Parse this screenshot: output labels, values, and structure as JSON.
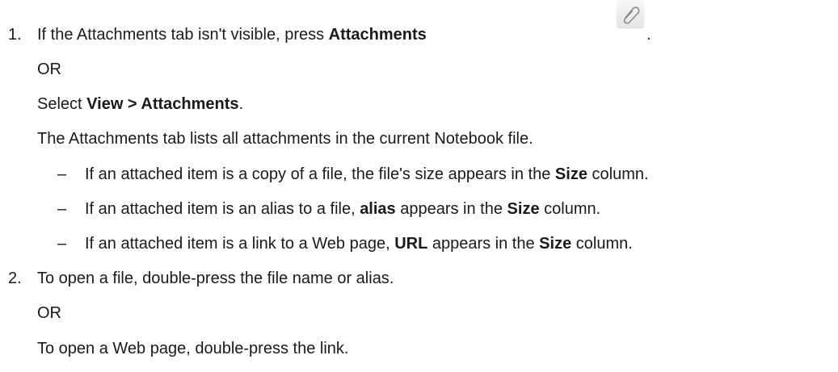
{
  "step1": {
    "number": "1.",
    "pre": "If the Attachments tab isn't visible, press ",
    "bold": "Attachments",
    "post": ".",
    "icon": "paperclip-icon",
    "or": "OR",
    "select_pre": "Select ",
    "select_bold": "View > Attachments",
    "select_post": ".",
    "description": "The Attachments tab lists all attachments in the current Notebook file.",
    "bullets": [
      {
        "dash": "–",
        "pre": "If an attached item is a copy of a file, the file's size appears in the ",
        "bold": "Size",
        "post": " column."
      },
      {
        "dash": "–",
        "pre": "If an attached item is an alias to a file, ",
        "bold1": "alias",
        "mid": " appears in the ",
        "bold2": "Size",
        "post": " column."
      },
      {
        "dash": "–",
        "pre": "If an attached item is a link to a Web page, ",
        "bold1": "URL",
        "mid": " appears in the ",
        "bold2": "Size",
        "post": " column."
      }
    ]
  },
  "step2": {
    "number": "2.",
    "text": "To open a file, double-press the file name or alias.",
    "or": "OR",
    "alt": "To open a Web page, double-press the link."
  }
}
